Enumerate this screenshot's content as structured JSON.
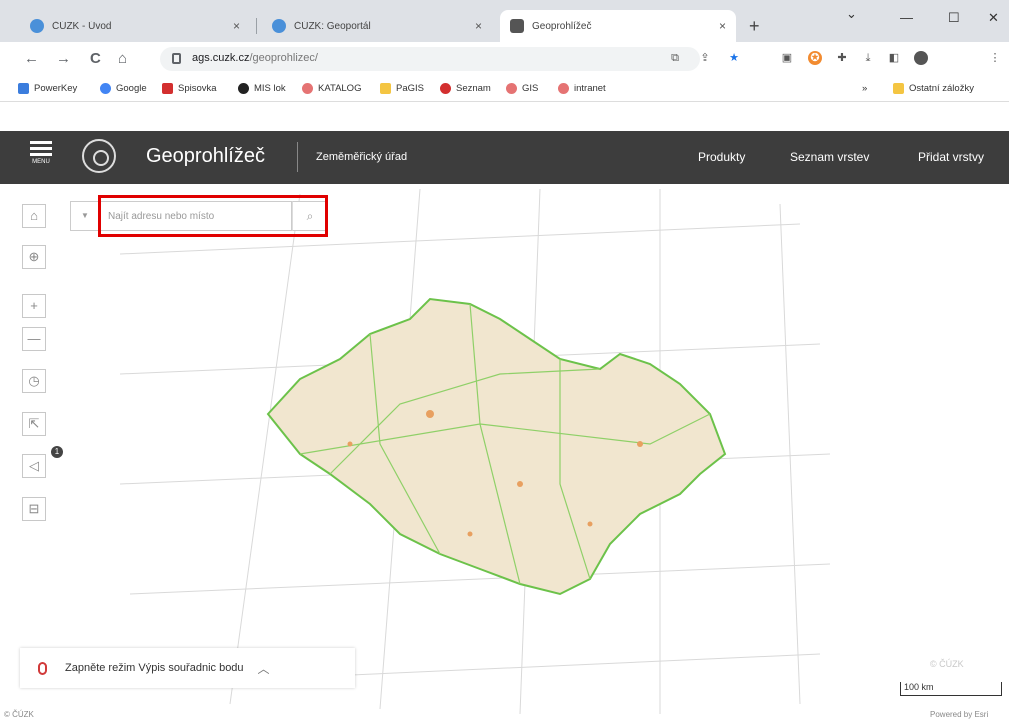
{
  "browser": {
    "tabs": [
      {
        "label": "ČÚZK - Úvod",
        "close": "×",
        "favicon_color": "#4a90d9"
      },
      {
        "label": "ČÚZK: Geoportál",
        "close": "×",
        "favicon_color": "#4a90d9"
      },
      {
        "label": "Geoprohlížeč",
        "close": "×",
        "favicon_color": "#555555"
      }
    ],
    "new_tab": "+",
    "window_controls": {
      "dropdown": "⌄",
      "minimize": "—",
      "maximize": "☐",
      "close": "✕"
    },
    "nav": {
      "back": "←",
      "forward": "→",
      "reload": "C",
      "home": "⌂"
    },
    "url": {
      "host": "ags.cuzk.cz",
      "path": "/geoprohlizec/"
    },
    "bookmarks": [
      {
        "label": "PowerKey",
        "color": "#3b7ddd"
      },
      {
        "label": "Google",
        "color": "#4285f4"
      },
      {
        "label": "Spisovka",
        "color": "#d32f2f"
      },
      {
        "label": "MIS lok",
        "color": "#222222"
      },
      {
        "label": "KATALOG",
        "color": "#e57373"
      },
      {
        "label": "PaGIS",
        "color": "#f4c542"
      },
      {
        "label": "Seznam",
        "color": "#d32f2f"
      },
      {
        "label": "GIS",
        "color": "#e57373"
      },
      {
        "label": "intranet",
        "color": "#e57373"
      }
    ],
    "bookmarks_overflow": "»",
    "other_bookmarks": "Ostatní záložky"
  },
  "app": {
    "menu_label": "MENU",
    "title": "Geoprohlížeč",
    "agency": "Zeměměřický úřad",
    "nav": [
      "Produkty",
      "Seznam vrstev",
      "Přidat vrstvy"
    ]
  },
  "map": {
    "search": {
      "placeholder": "Najít adresu nebo místo",
      "value": ""
    },
    "tools": [
      {
        "name": "home-icon",
        "glyph": "⌂"
      },
      {
        "name": "locate-icon",
        "glyph": "⊕"
      },
      {
        "name": "zoom-in-icon",
        "glyph": "+"
      },
      {
        "name": "zoom-out-icon",
        "glyph": "—"
      },
      {
        "name": "power-icon",
        "glyph": "◷"
      },
      {
        "name": "share-icon",
        "glyph": "⇱"
      },
      {
        "name": "announcement-icon",
        "glyph": "◁"
      },
      {
        "name": "print-icon",
        "glyph": "⊟"
      }
    ],
    "notification_count": "1",
    "coord_mode_text": "Zapněte režim Výpis souřadnic bodu",
    "scale_label": "100 km",
    "watermark": "© ČÚZK",
    "copyright": "© ČÚZK",
    "powered_by": "Powered by Esri",
    "country_border_color": "#6cc24a",
    "map_fill_color": "#f1e6cf"
  }
}
